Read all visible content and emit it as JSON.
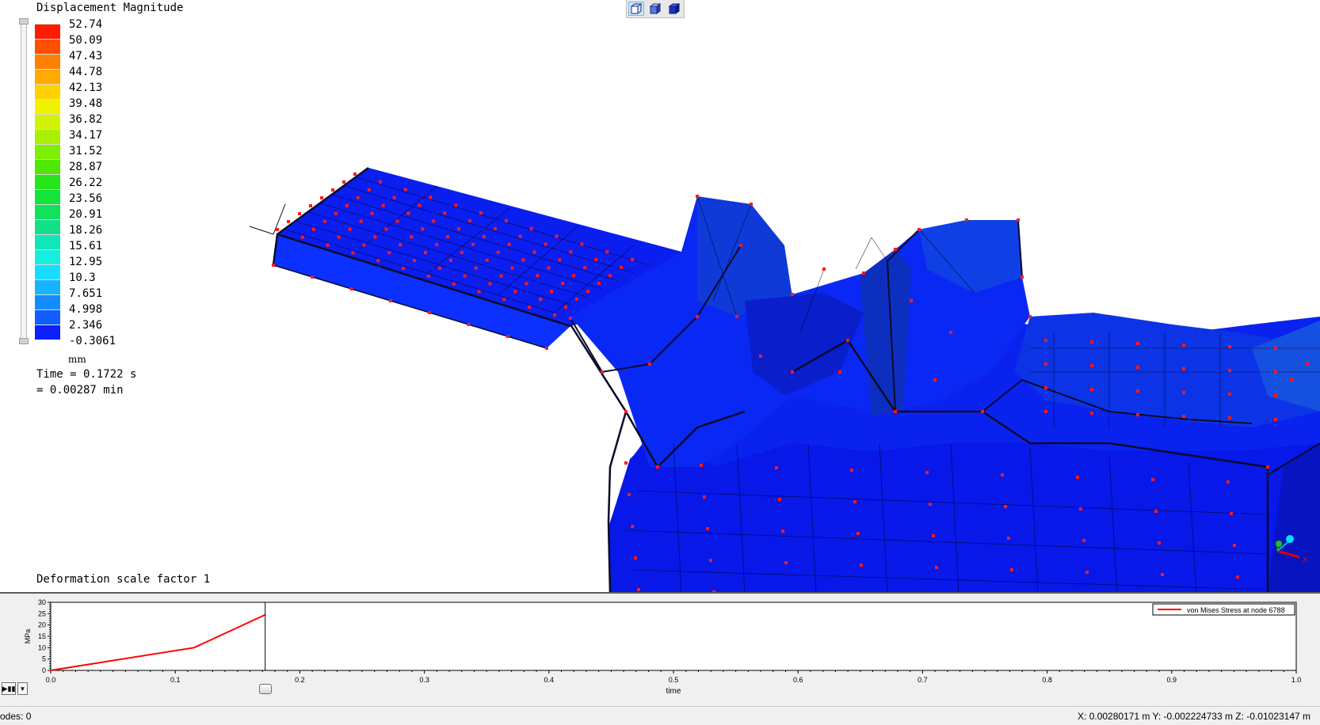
{
  "legend": {
    "title": "Displacement Magnitude",
    "unit": "mm",
    "values": [
      "52.74",
      "50.09",
      "47.43",
      "44.78",
      "42.13",
      "39.48",
      "36.82",
      "34.17",
      "31.52",
      "28.87",
      "26.22",
      "23.56",
      "20.91",
      "18.26",
      "15.61",
      "12.95",
      "10.3",
      "7.651",
      "4.998",
      "2.346",
      "-0.3061"
    ],
    "colors": [
      "#ff1a00",
      "#ff4f00",
      "#ff7f00",
      "#ffaa00",
      "#ffd200",
      "#f2f200",
      "#d4f200",
      "#aaf000",
      "#7def00",
      "#4ee800",
      "#26e61a",
      "#13e43c",
      "#10e25e",
      "#12e08a",
      "#12e6b8",
      "#15f0e0",
      "#1adcff",
      "#16b4ff",
      "#128cff",
      "#0f5eff",
      "#0a20ff"
    ]
  },
  "time": {
    "seconds": "Time = 0.1722 s",
    "minutes": "= 0.00287 min"
  },
  "deformation": "Deformation scale factor 1",
  "view_toolbar": [
    "wireframe-cube-icon",
    "shaded-cube-icon",
    "solid-cube-icon"
  ],
  "mesh": {
    "face_color": "#0a1eff",
    "node_color": "#ff1a1a",
    "edge_color": "#000000"
  },
  "chart_data": {
    "type": "line",
    "xlabel": "time",
    "ylabel": "MPa",
    "xlim": [
      0.0,
      1.0
    ],
    "ylim": [
      0,
      30
    ],
    "xticks": [
      "0.0",
      "0.1",
      "0.2",
      "0.3",
      "0.4",
      "0.5",
      "0.6",
      "0.7",
      "0.8",
      "0.9",
      "1.0"
    ],
    "yticks": [
      "0",
      "5",
      "10",
      "15",
      "20",
      "25",
      "30"
    ],
    "series": [
      {
        "name": "von Mises Stress at node 6788",
        "color": "#ff0000",
        "x": [
          0.0,
          0.115,
          0.1722
        ],
        "y": [
          0,
          10,
          24.5
        ]
      }
    ],
    "cursor_x": 0.1722,
    "legend_position": "top-right"
  },
  "status": {
    "nodes": "odes: 0",
    "coords": "X: 0.00280171 m Y: -0.002224733 m Z: -0.01023147 m"
  }
}
